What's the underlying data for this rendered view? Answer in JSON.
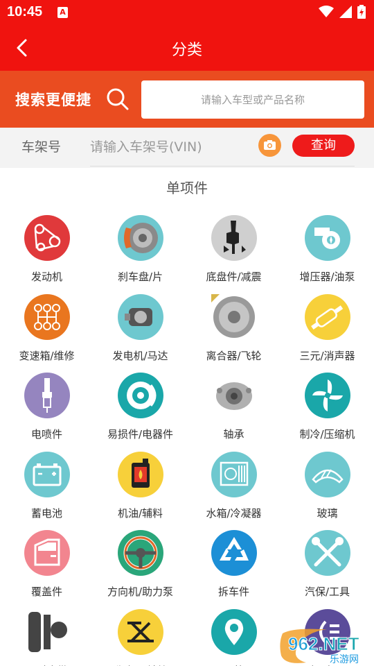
{
  "status": {
    "time": "10:45",
    "notif_glyph": "A"
  },
  "header": {
    "title": "分类",
    "back_icon": "chevron-left-icon"
  },
  "search": {
    "slogan": "搜索更便捷",
    "placeholder": "请输入车型或产品名称"
  },
  "vin": {
    "label": "车架号",
    "placeholder": "请输入车架号(VIN)",
    "query_label": "查询"
  },
  "section": {
    "title": "单项件"
  },
  "categories": [
    {
      "label": "发动机",
      "icon": "engine-belt-icon",
      "color": "#e0393b"
    },
    {
      "label": "刹车盘/片",
      "icon": "brake-disc-icon",
      "color": "#6ec8cf"
    },
    {
      "label": "底盘件/减震",
      "icon": "shock-absorber-icon",
      "color": "#cfcfcf"
    },
    {
      "label": "增压器/油泵",
      "icon": "turbocharger-icon",
      "color": "#6ec8cf"
    },
    {
      "label": "变速箱/维修",
      "icon": "gearbox-icon",
      "color": "#e9761f"
    },
    {
      "label": "发电机/马达",
      "icon": "alternator-icon",
      "color": "#6ec8cf"
    },
    {
      "label": "离合器/飞轮",
      "icon": "clutch-icon",
      "color": "#9a9a9a"
    },
    {
      "label": "三元/消声器",
      "icon": "muffler-icon",
      "color": "#f7d03a"
    },
    {
      "label": "电喷件",
      "icon": "spark-plug-icon",
      "color": "#9585bf"
    },
    {
      "label": "易损件/电器件",
      "icon": "disc-part-icon",
      "color": "#1aa7a9"
    },
    {
      "label": "轴承",
      "icon": "wheel-bearing-icon",
      "color": "#dcdcdc"
    },
    {
      "label": "制冷/压缩机",
      "icon": "fan-icon",
      "color": "#1aa7a9"
    },
    {
      "label": "蓄电池",
      "icon": "battery-icon",
      "color": "#6ec8cf"
    },
    {
      "label": "机油/辅料",
      "icon": "oil-can-icon",
      "color": "#f7d03a"
    },
    {
      "label": "水箱/冷凝器",
      "icon": "radiator-icon",
      "color": "#6ec8cf"
    },
    {
      "label": "玻璃",
      "icon": "windshield-icon",
      "color": "#6ec8cf"
    },
    {
      "label": "覆盖件",
      "icon": "car-door-icon",
      "color": "#f2858f"
    },
    {
      "label": "方向机/助力泵",
      "icon": "steering-wheel-icon",
      "color": "#2aa67a"
    },
    {
      "label": "拆车件",
      "icon": "recycle-icon",
      "color": "#1c8fd6"
    },
    {
      "label": "汽保/工具",
      "icon": "wrench-tools-icon",
      "color": "#6ec8cf"
    },
    {
      "label": "正时皮带",
      "icon": "timing-belt-icon",
      "color": "#9a9a9a"
    },
    {
      "label": "升降器/锁块",
      "icon": "lift-icon",
      "color": "#f7d03a"
    },
    {
      "label": "导航",
      "icon": "location-pin-icon",
      "color": "#1aa7a9"
    },
    {
      "label": "灯/电器",
      "icon": "light-icon",
      "color": "#5b4c9a"
    }
  ],
  "watermark": {
    "line1": "962.NET",
    "line2": "乐游网"
  },
  "colors": {
    "brand_red": "#f0130f",
    "search_orange": "#ea4c20",
    "query_red": "#ee1b1b",
    "camera_orange": "#f7953a"
  }
}
